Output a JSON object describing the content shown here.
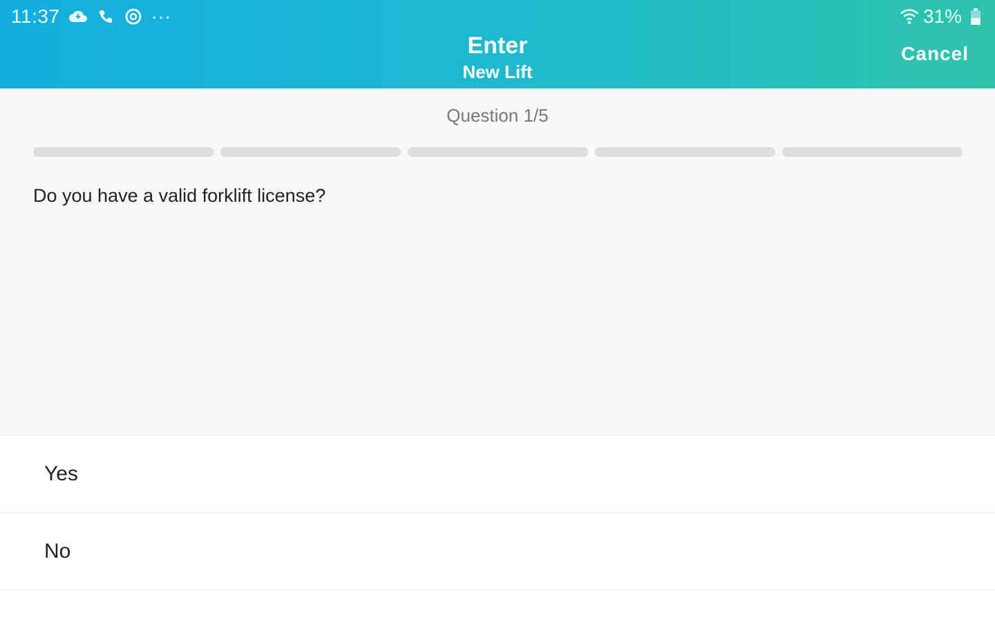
{
  "status_bar": {
    "time": "11:37",
    "more": "···",
    "battery": "31%",
    "icons": [
      "cloud-icon",
      "phone-icon",
      "sync-icon",
      "wifi-icon",
      "battery-icon"
    ]
  },
  "header": {
    "title": "Enter",
    "subtitle": "New Lift",
    "cancel_label": "Cancel",
    "gradient_start": "#14aede",
    "gradient_end": "#2ec4ad"
  },
  "question": {
    "counter": "Question 1/5",
    "progress": {
      "current": 1,
      "total": 5
    },
    "text": "Do you have a valid forklift license?"
  },
  "answers": [
    {
      "label": "Yes"
    },
    {
      "label": "No"
    }
  ]
}
